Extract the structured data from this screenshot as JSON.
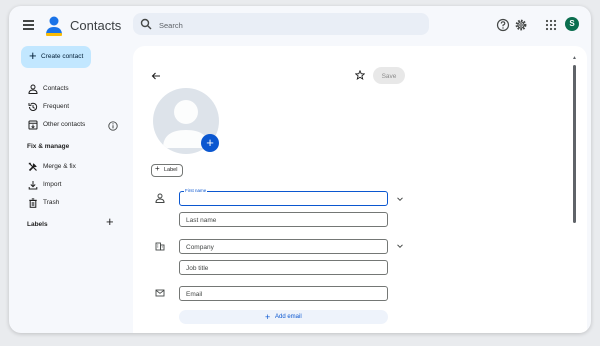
{
  "app": {
    "title": "Contacts"
  },
  "search": {
    "placeholder": "Search"
  },
  "user": {
    "avatar_letter": "S",
    "avatar_color": "#0b6e4f"
  },
  "sidebar": {
    "create_label": "Create contact",
    "items": [
      {
        "label": "Contacts",
        "icon": "person-icon"
      },
      {
        "label": "Frequent",
        "icon": "history-icon"
      },
      {
        "label": "Other contacts",
        "icon": "archive-download-icon"
      }
    ],
    "fix_heading": "Fix & manage",
    "fix_items": [
      {
        "label": "Merge & fix",
        "icon": "tools-icon"
      },
      {
        "label": "Import",
        "icon": "download-icon"
      },
      {
        "label": "Trash",
        "icon": "trash-icon"
      }
    ],
    "labels_heading": "Labels"
  },
  "form": {
    "save_label": "Save",
    "label_button": "Label",
    "first_name_label": "First name",
    "first_name_value": "",
    "last_name_placeholder": "Last name",
    "company_placeholder": "Company",
    "job_title_placeholder": "Job title",
    "email_placeholder": "Email",
    "add_email_label": "Add email"
  },
  "colors": {
    "accent": "#0b57d0",
    "create_bg": "#c2e7ff",
    "window_bg": "#f6f8fc"
  }
}
